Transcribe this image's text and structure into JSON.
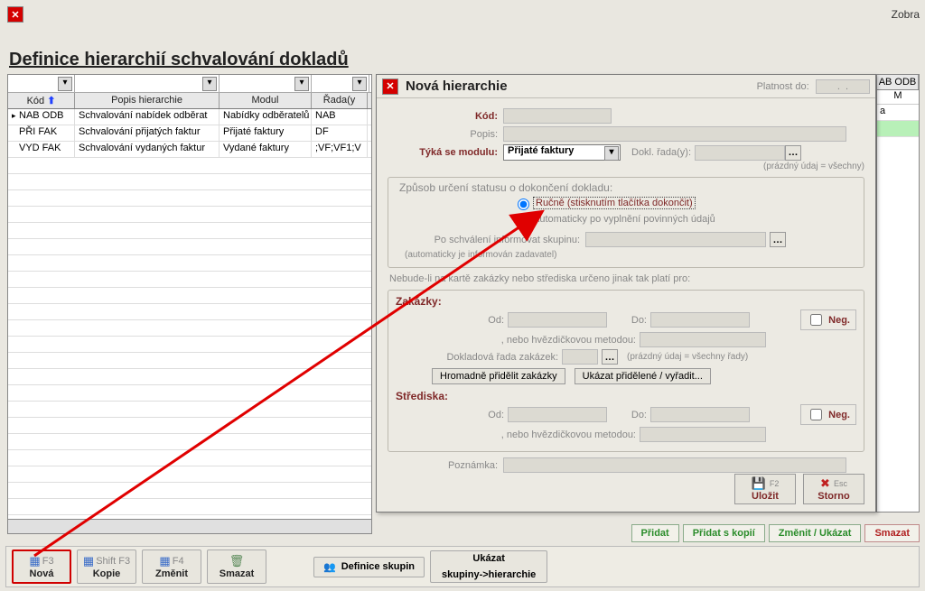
{
  "topbar": {
    "right_label": "Zobra"
  },
  "page_title": "Definice hierarchií schvalování dokladů",
  "grid": {
    "headers": {
      "kod": "Kód",
      "popis": "Popis hierarchie",
      "modul": "Modul",
      "rada": "Řada(y"
    },
    "rows": [
      {
        "kod": "NAB ODB",
        "popis": "Schvalování nabídek odběrat",
        "modul": "Nabídky odběratelů",
        "rada": "NAB"
      },
      {
        "kod": "PŘI FAK",
        "popis": "Schvalování přijatých faktur",
        "modul": "Přijaté faktury",
        "rada": "DF"
      },
      {
        "kod": "VYD FAK",
        "popis": "Schvalování vydaných faktur",
        "modul": "Vydané faktury",
        "rada": ";VF;VF1;V"
      }
    ]
  },
  "right_grid": {
    "header1": "AB ODB",
    "header2": "M",
    "cell1": "a"
  },
  "dialog": {
    "title": "Nová hierarchie",
    "platnost_label": "Platnost do:",
    "platnost_value": ".  .",
    "kod_label": "Kód:",
    "popis_label": "Popis:",
    "modul_label": "Týká se modulu:",
    "modul_value": "Přijaté faktury",
    "rady_label": "Dokl. řada(y):",
    "rady_note": "(prázdný údaj = všechny)",
    "status_legend": "Způsob určení statusu o dokončení dokladu:",
    "status_opt1": "Ručně (stisknutím tlačítka dokončit)",
    "status_opt2": "Automaticky po vyplnění povinných údajů",
    "inform_label": "Po schválení informovat skupinu:",
    "inform_note": "(automaticky je informován zadavatel)",
    "nebude_li": "Nebude-li na kartě zakázky nebo střediska určeno jinak tak platí pro:",
    "zakazky_title": "Zakázky:",
    "od": "Od:",
    "do": "Do:",
    "hvezd": ", nebo hvězdičkovou metodou:",
    "neg": "Neg.",
    "dokl_rada_zak": "Dokladová řada zakázek:",
    "dokl_rada_zak_note": "(prázdný údaj = všechny řady)",
    "btn_hromadne": "Hromadně přidělit zakázky",
    "btn_ukazat_prid": "Ukázat přidělené / vyřadit...",
    "strediska_title": "Střediska:",
    "poznamka_label": "Poznámka:",
    "save_shortcut": "F2",
    "save_label": "Uložit",
    "storno_shortcut": "Esc",
    "storno_label": "Storno"
  },
  "lower_right": {
    "pridat": "Přidat",
    "pridat_kopii": "Přidat s kopií",
    "zmenit": "Změnit / Ukázat",
    "smazat": "Smazat"
  },
  "toolbar": {
    "nova_sc": "F3",
    "nova": "Nová",
    "kopie_sc": "Shift F3",
    "kopie": "Kopie",
    "zmenit_sc": "F4",
    "zmenit": "Změnit",
    "smazat": "Smazat",
    "def_skupin": "Definice skupin",
    "ukazat_skup1": "Ukázat",
    "ukazat_skup2": "skupiny->hierarchie"
  }
}
